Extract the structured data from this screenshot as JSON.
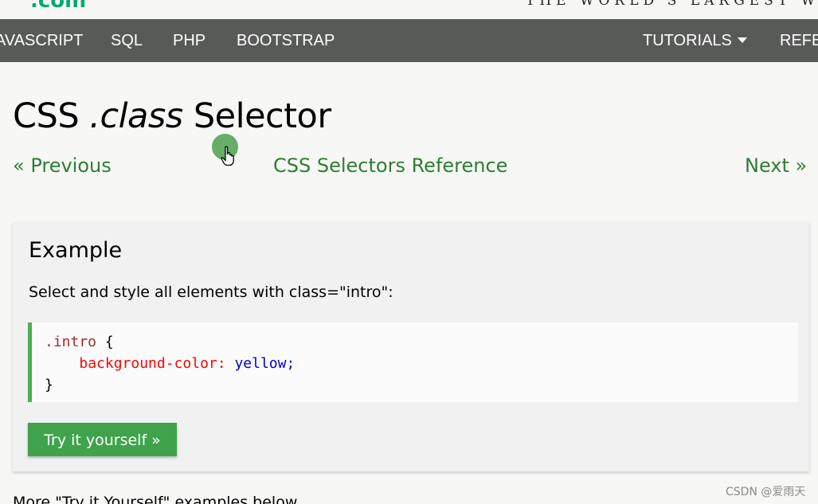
{
  "header": {
    "logo_text": ".com",
    "tagline": "THE WORLD'S LARGEST WEB DEVELOPER SITE"
  },
  "nav": {
    "items": [
      {
        "label": "JAVASCRIPT"
      },
      {
        "label": "SQL"
      },
      {
        "label": "PHP"
      },
      {
        "label": "BOOTSTRAP"
      },
      {
        "label": "TUTORIALS"
      },
      {
        "label": "REFERENCES"
      }
    ]
  },
  "page": {
    "title_prefix": "CSS",
    "title_emph": ".class",
    "title_suffix": "Selector",
    "prev_link": "« Previous",
    "ref_link": "CSS Selectors Reference",
    "next_link": "Next »"
  },
  "example": {
    "heading": "Example",
    "description": "Select and style all elements with class=\"intro\":",
    "code": {
      "selector": ".intro",
      "open_brace": "{",
      "property": "background-color:",
      "value": "yellow;",
      "close_brace": "}"
    },
    "button_label": "Try it yourself »"
  },
  "more_examples": "More \"Try it Yourself\" examples below.",
  "watermark": "CSDN @爱雨天",
  "colors": {
    "accent_green": "#04aa6d",
    "nav_bg": "#585a58",
    "link_green": "#2e7d32",
    "button_green": "#3ea34a"
  },
  "icons": {
    "cursor": "hand-pointer-icon",
    "tutorials_dropdown": "caret-down-icon"
  }
}
